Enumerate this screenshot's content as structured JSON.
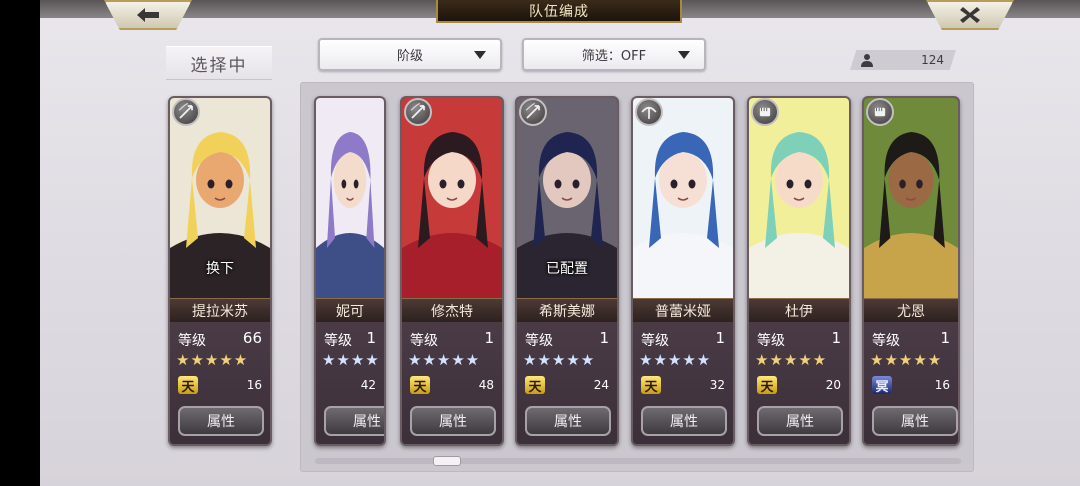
{
  "header": {
    "title": "队伍编成"
  },
  "selecting_label": "选择中",
  "dropdowns": {
    "class": "阶级",
    "filter": "筛选：OFF"
  },
  "unit_count": "124",
  "level_label": "等级",
  "attr_label": "属性",
  "selected": {
    "name": "提拉米苏",
    "level": "66",
    "stars": "★★★★★",
    "star_color": "#f1d07a",
    "rank": "天",
    "cost": "16",
    "overlay": "换下",
    "portrait_colors": {
      "bg": "#ece6d6",
      "hair": "#f2d15a",
      "skin": "#e9a86f",
      "cloth": "#2b2326"
    },
    "class_icon": "bow-icon"
  },
  "roster": [
    {
      "name": "妮可",
      "level": "1",
      "stars": "★★★★",
      "star_color": "#d4e2ff",
      "rank": "",
      "cost": "42",
      "overlay": "",
      "portrait_colors": {
        "bg": "#efeaf4",
        "hair": "#8e7ac8",
        "skin": "#f3dccb",
        "cloth": "#3d4f86"
      },
      "class_icon": ""
    },
    {
      "name": "修杰特",
      "level": "1",
      "stars": "★★★★★",
      "star_color": "#d4e2ff",
      "rank": "天",
      "cost": "48",
      "overlay": "",
      "portrait_colors": {
        "bg": "#c73a3a",
        "hair": "#2b1a1f",
        "skin": "#f5d8c8",
        "cloth": "#a61f2a"
      },
      "class_icon": "bow-icon"
    },
    {
      "name": "希斯美娜",
      "level": "1",
      "stars": "★★★★★",
      "star_color": "#d4e2ff",
      "rank": "天",
      "cost": "24",
      "overlay": "已配置",
      "portrait_colors": {
        "bg": "#6a6470",
        "hair": "#1f2550",
        "skin": "#e3c8c0",
        "cloth": "#2a2530"
      },
      "class_icon": "bow-icon"
    },
    {
      "name": "普蕾米娅",
      "level": "1",
      "stars": "★★★★★",
      "star_color": "#d4e2ff",
      "rank": "天",
      "cost": "32",
      "overlay": "",
      "portrait_colors": {
        "bg": "#eef3f8",
        "hair": "#3a66b8",
        "skin": "#f6e0d6",
        "cloth": "#f4f6fa"
      },
      "class_icon": "crossbow-icon"
    },
    {
      "name": "杜伊",
      "level": "1",
      "stars": "★★★★★",
      "star_color": "#f1d07a",
      "rank": "天",
      "cost": "20",
      "overlay": "",
      "portrait_colors": {
        "bg": "#f2ef9a",
        "hair": "#7fd0b8",
        "skin": "#f6dcc8",
        "cloth": "#f3f0e6"
      },
      "class_icon": "fist-icon"
    },
    {
      "name": "尤恩",
      "level": "1",
      "stars": "★★★★★",
      "star_color": "#f1d07a",
      "rank": "冥",
      "cost": "16",
      "overlay": "",
      "portrait_colors": {
        "bg": "#6e8a3a",
        "hair": "#1d1a18",
        "skin": "#9b6a45",
        "cloth": "#c7a34a"
      },
      "class_icon": "fist-icon"
    }
  ]
}
